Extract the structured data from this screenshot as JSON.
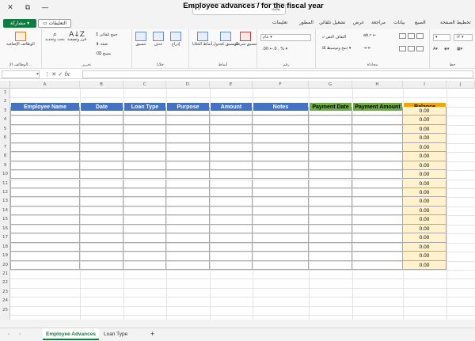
{
  "titlebar": {
    "search_placeholder": "بحث",
    "search_icon": "search-icon"
  },
  "tabs": [
    "تخطيط الصفحة",
    "الصيغ",
    "بيانات",
    "مراجعة",
    "عرض",
    "تشغيل تلقائي",
    "المطور",
    "تعليمات"
  ],
  "share_label": "مشاركة",
  "comments_label": "التعليقات",
  "ribbon": {
    "groups": {
      "font": "خط",
      "alignment": "محاذاة",
      "number": "رقم",
      "styles": "أنماط",
      "cells": "خلايا",
      "editing": "تحرير",
      "addins": "الوظائف الإ..."
    },
    "font_size": "١٢",
    "number_format": "عام",
    "wrap_text": "التفاف النص",
    "merge_center": "دمج وتوسيط",
    "cond_format": "تنسيق شرطي",
    "format_table": "التنسيق كجدول",
    "cell_styles": "أنماط الخلايا",
    "insert": "إدراج",
    "delete": "حذف",
    "format": "تنسيق",
    "autosum": "جمع تلقائي",
    "fill": "تعبئة",
    "clear": "مسح",
    "sort_filter": "فرز وتصفية",
    "find_select": "بحث وتحديد",
    "addins_btn": "الوظائف الإضافية"
  },
  "formula_bar": {
    "name_box": "",
    "fx": "fx",
    "formula": ""
  },
  "columns": [
    "A",
    "B",
    "C",
    "D",
    "E",
    "F",
    "G",
    "H",
    "I",
    "J"
  ],
  "rows": [
    "1",
    "2",
    "3",
    "4",
    "5",
    "6",
    "7",
    "8",
    "9",
    "10",
    "11",
    "12",
    "13",
    "14",
    "15",
    "16",
    "17",
    "18",
    "19",
    "20",
    "21",
    "22",
    "23",
    "24",
    "25"
  ],
  "sheet": {
    "title": "Employee advances / for the fiscal year",
    "headers": {
      "name": "Employee Name",
      "date": "Date",
      "loan_type": "Loan Type",
      "purpose": "Purpose",
      "amount": "Amount",
      "notes": "Notes",
      "pay_date": "Payment Date",
      "pay_amount": "Payment Amount",
      "balance": "Balance"
    },
    "balance_values": [
      "0.00",
      "0.00",
      "0.00",
      "0.00",
      "0.00",
      "0.00",
      "0.00",
      "0.00",
      "0.00",
      "0.00",
      "0.00",
      "0.00",
      "0.00",
      "0.00",
      "0.00",
      "0.00",
      "0.00",
      "0.00"
    ],
    "colors": {
      "header_blue": "#4472c4",
      "header_green": "#70ad47",
      "header_orange": "#f2a20b",
      "balance_fill": "#fff2cc"
    }
  },
  "sheet_tabs": [
    "Employee Advances",
    "Loan Type"
  ],
  "add_sheet": "+"
}
